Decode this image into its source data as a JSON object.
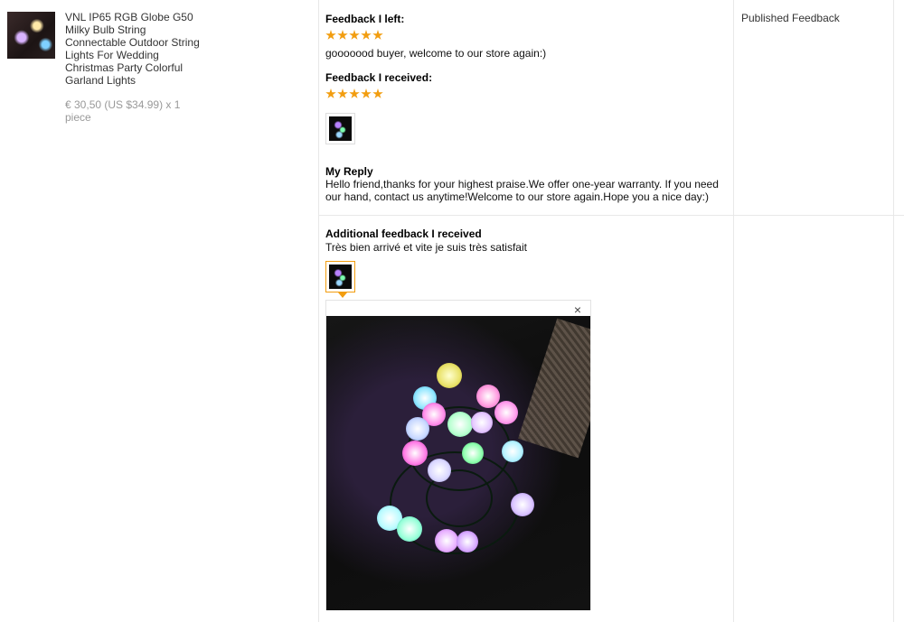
{
  "product": {
    "title": "VNL IP65 RGB Globe G50 Milky Bulb String Connectable Outdoor String Lights For Wedding Christmas Party Colorful Garland Lights",
    "price": "€ 30,50 (US $34.99) x 1 piece"
  },
  "feedback_left": {
    "label": "Feedback I left:",
    "rating": 5,
    "comment": "gooooood buyer, welcome to our store again:)"
  },
  "feedback_received": {
    "label": "Feedback I received:",
    "rating": 5
  },
  "reply": {
    "label": "My Reply",
    "text": "Hello friend,thanks for your highest praise.We offer one-year warranty. If you need our hand, contact us anytime!Welcome to our store again.Hope you a nice day:)"
  },
  "additional": {
    "label": "Additional feedback I received",
    "text": "Très bien arrivé et vite je suis très satisfait"
  },
  "viewer": {
    "close_label": "×"
  },
  "status": {
    "label": "Published Feedback"
  },
  "colors": {
    "star": "#f29d0f",
    "active_border": "#f29d0f"
  }
}
